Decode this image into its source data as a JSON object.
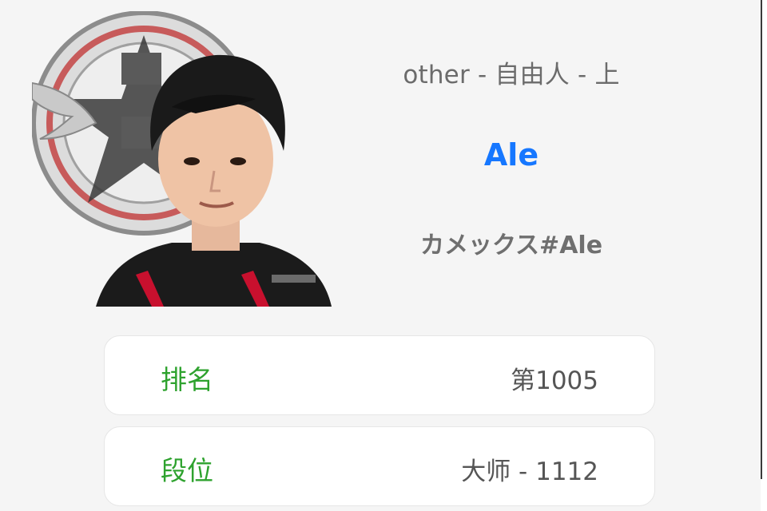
{
  "player": {
    "subtitle": "other - 自由人 - 上",
    "name": "Ale",
    "game_id": "カメックス#Ale",
    "avatar_icon": "player-photo-with-team-logo"
  },
  "stats": [
    {
      "label": "排名",
      "value": "第1005"
    },
    {
      "label": "段位",
      "value": "大师 - 1112"
    }
  ],
  "colors": {
    "name": "#1677ff",
    "label": "#2ea22e",
    "value": "#555555",
    "subtitle": "#6b6b6b",
    "background": "#f5f5f5"
  }
}
